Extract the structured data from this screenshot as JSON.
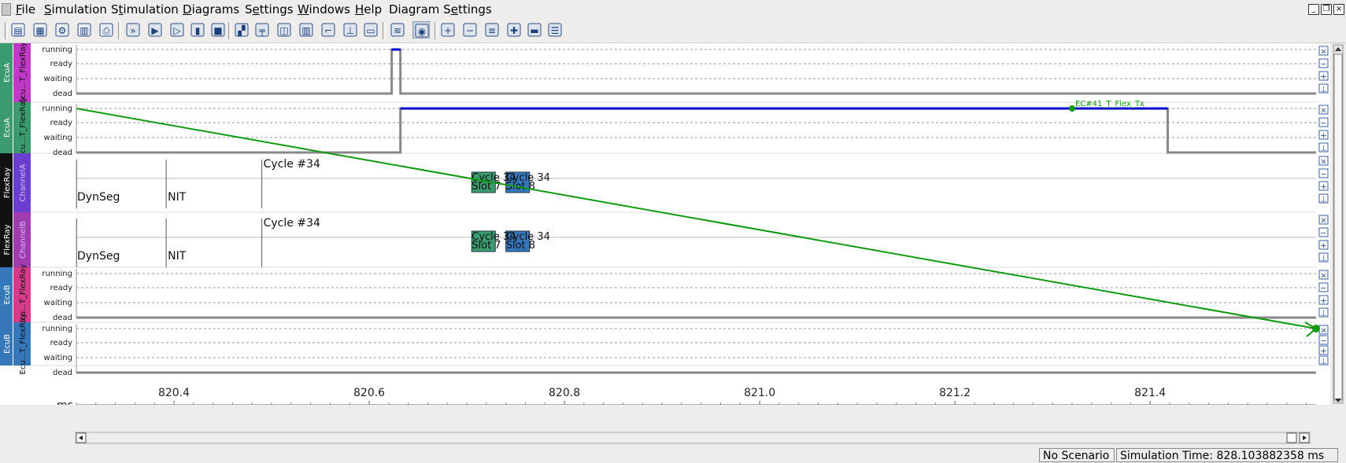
{
  "menubar": {
    "items": [
      {
        "pre": "",
        "ul": "F",
        "post": "ile"
      },
      {
        "pre": "",
        "ul": "S",
        "post": "imulation"
      },
      {
        "pre": "S",
        "ul": "t",
        "post": "imulation"
      },
      {
        "pre": "",
        "ul": "D",
        "post": "iagrams"
      },
      {
        "pre": "S",
        "ul": "e",
        "post": "ttings"
      },
      {
        "pre": "",
        "ul": "W",
        "post": "indows"
      },
      {
        "pre": "",
        "ul": "H",
        "post": "elp"
      },
      {
        "pre": "Diagram S",
        "ul": "e",
        "post": "ttings"
      }
    ]
  },
  "toolbar": {
    "icons": [
      "open-icon",
      "save-icon",
      "settings-icon",
      "report-icon",
      "print-icon",
      "fast-forward-icon",
      "play-icon",
      "step-icon",
      "pause-icon",
      "stop-icon",
      "gantt-icon",
      "tree-icon",
      "histogram-icon",
      "candle-icon",
      "step-line-icon",
      "hierarchy-icon",
      "timeline-icon",
      "chart-icon",
      "eye-icon",
      "zoom-in-icon",
      "zoom-out-icon",
      "expand-icon",
      "add-icon",
      "remove-icon",
      "list-icon"
    ]
  },
  "lanes": [
    {
      "group": "EcuA",
      "task": "Ecu...T_FlexRay",
      "group_color": "#3c9a6f",
      "task_color": "#c13ac7",
      "kind": "state"
    },
    {
      "group": "EcuA",
      "task": "Ecu...T_FlexRay",
      "group_color": "#3c9a6f",
      "task_color": "#3c9a6f",
      "kind": "state"
    },
    {
      "group": "FlexRay",
      "task": "ChannelA",
      "group_color": "#111111",
      "task_color": "#6a3fd0",
      "kind": "bus"
    },
    {
      "group": "FlexRay",
      "task": "ChannelB",
      "group_color": "#111111",
      "task_color": "#a03bb0",
      "kind": "bus"
    },
    {
      "group": "EcuB",
      "task": "Ecu...T_FlexRay",
      "group_color": "#3577b8",
      "task_color": "#d63a8a",
      "kind": "state"
    },
    {
      "group": "EcuB",
      "task": "Ecu...T_FlexRay",
      "group_color": "#3577b8",
      "task_color": "#3577b8",
      "kind": "state"
    }
  ],
  "state_labels": [
    "running",
    "ready",
    "waiting",
    "dead"
  ],
  "bus_text": {
    "dynseg": "DynSeg",
    "nit": "NIT",
    "cycle": "Cycle #34",
    "frame_a": "Cycle 34",
    "frame_a_slot": "Slot 7",
    "frame_b": "Cycle 34",
    "frame_b_slot": "Slot 8"
  },
  "event_chain_label": "EC#41_T_Flex_Tx",
  "axis": {
    "unit": "ms",
    "range": [
      820.3,
      821.57
    ],
    "ticks": [
      820.4,
      820.6,
      820.8,
      821.0,
      821.2,
      821.4
    ],
    "tick_labels": [
      "820.4",
      "820.6",
      "820.8",
      "821.0",
      "821.2",
      "821.4"
    ]
  },
  "lane_controls": [
    "close-icon",
    "zoom-out-icon",
    "zoom-in-icon",
    "zoom-fit-icon"
  ],
  "status": {
    "scenario": "No Scenario",
    "simulation_time": "Simulation Time: 828.103882358 ms"
  },
  "colors": {
    "state_line": "#888888",
    "running_line": "#0000cc",
    "event_chain": "#119911",
    "frame_a": "#3c9a6f",
    "frame_b": "#3577b8"
  }
}
